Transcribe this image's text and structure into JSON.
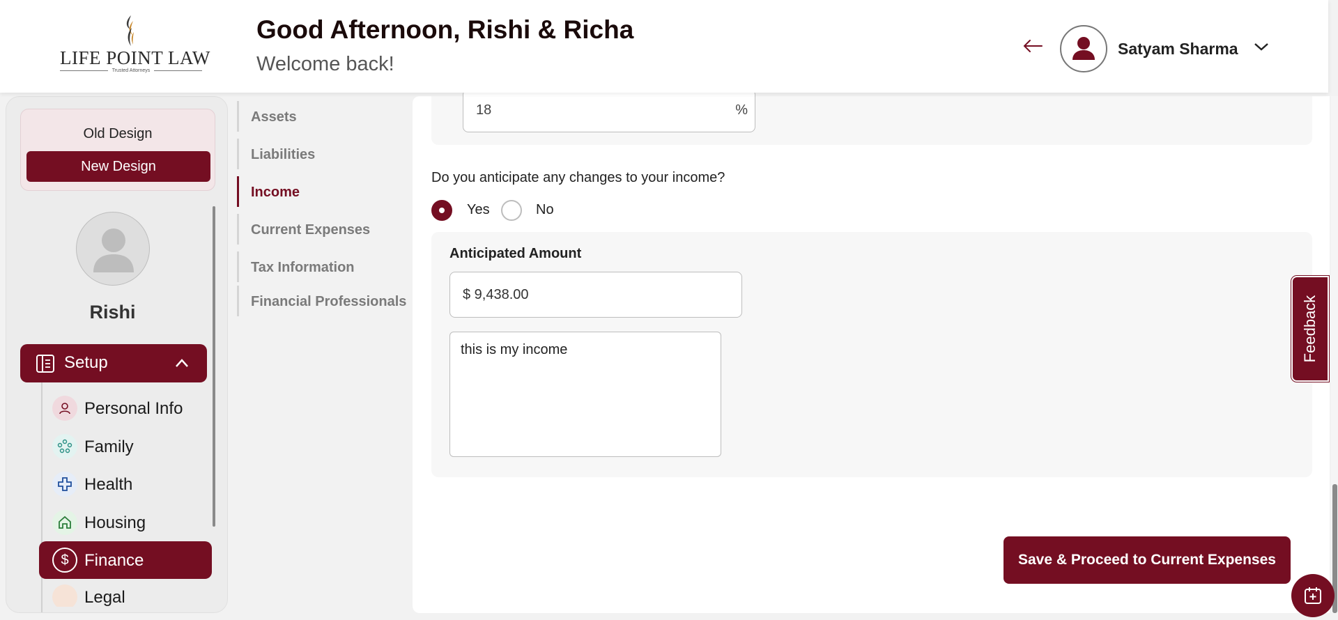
{
  "header": {
    "logo_text": "LIFE POINT LAW",
    "logo_tagline": "Trusted Attorneys",
    "greeting": "Good Afternoon, Rishi & Richa",
    "welcome": "Welcome back!",
    "user_name": "Satyam Sharma"
  },
  "design_toggle": {
    "old_label": "Old Design",
    "new_label": "New Design"
  },
  "profile": {
    "name": "Rishi"
  },
  "sidebar": {
    "section_label": "Setup",
    "items": [
      {
        "label": "Personal Info",
        "icon": "person-icon",
        "active": false
      },
      {
        "label": "Family",
        "icon": "family-icon",
        "active": false
      },
      {
        "label": "Health",
        "icon": "health-cross-icon",
        "active": false
      },
      {
        "label": "Housing",
        "icon": "house-icon",
        "active": false
      },
      {
        "label": "Finance",
        "icon": "dollar-icon",
        "active": true
      },
      {
        "label": "Legal",
        "icon": "legal-icon",
        "active": false
      }
    ]
  },
  "finance_nav": {
    "items": [
      {
        "label": "Assets",
        "active": false
      },
      {
        "label": "Liabilities",
        "active": false
      },
      {
        "label": "Income",
        "active": true
      },
      {
        "label": "Current Expenses",
        "active": false
      },
      {
        "label": "Tax Information",
        "active": false
      },
      {
        "label": "Financial Professionals",
        "active": false
      }
    ]
  },
  "form": {
    "percent_value": "18",
    "percent_suffix": "%",
    "question": "Do you anticipate any changes to your income?",
    "option_yes": "Yes",
    "option_no": "No",
    "selected": "Yes",
    "amount_title": "Anticipated Amount",
    "amount_value": "$ 9,438.00",
    "notes_value": "this is my income",
    "save_label": "Save & Proceed to Current Expenses"
  },
  "feedback_label": "Feedback",
  "colors": {
    "brand": "#740e22",
    "panel": "#ececec",
    "card": "#f7f7f7"
  }
}
